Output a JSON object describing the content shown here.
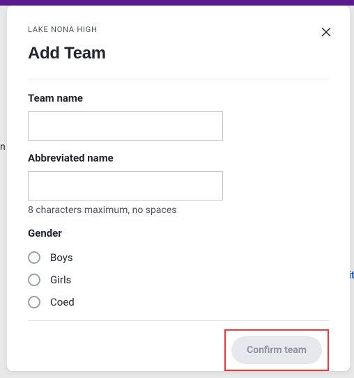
{
  "modal": {
    "subtitle": "LAKE NONA HIGH",
    "title": "Add Team",
    "close_aria": "Close"
  },
  "form": {
    "team_name": {
      "label": "Team name",
      "value": ""
    },
    "abbreviated_name": {
      "label": "Abbreviated name",
      "value": "",
      "hint": "8 characters maximum, no spaces"
    },
    "gender": {
      "label": "Gender",
      "options": [
        "Boys",
        "Girls",
        "Coed"
      ]
    }
  },
  "actions": {
    "confirm": "Confirm team"
  },
  "background": {
    "edit_fragment": "it",
    "left_fragment": "n"
  }
}
